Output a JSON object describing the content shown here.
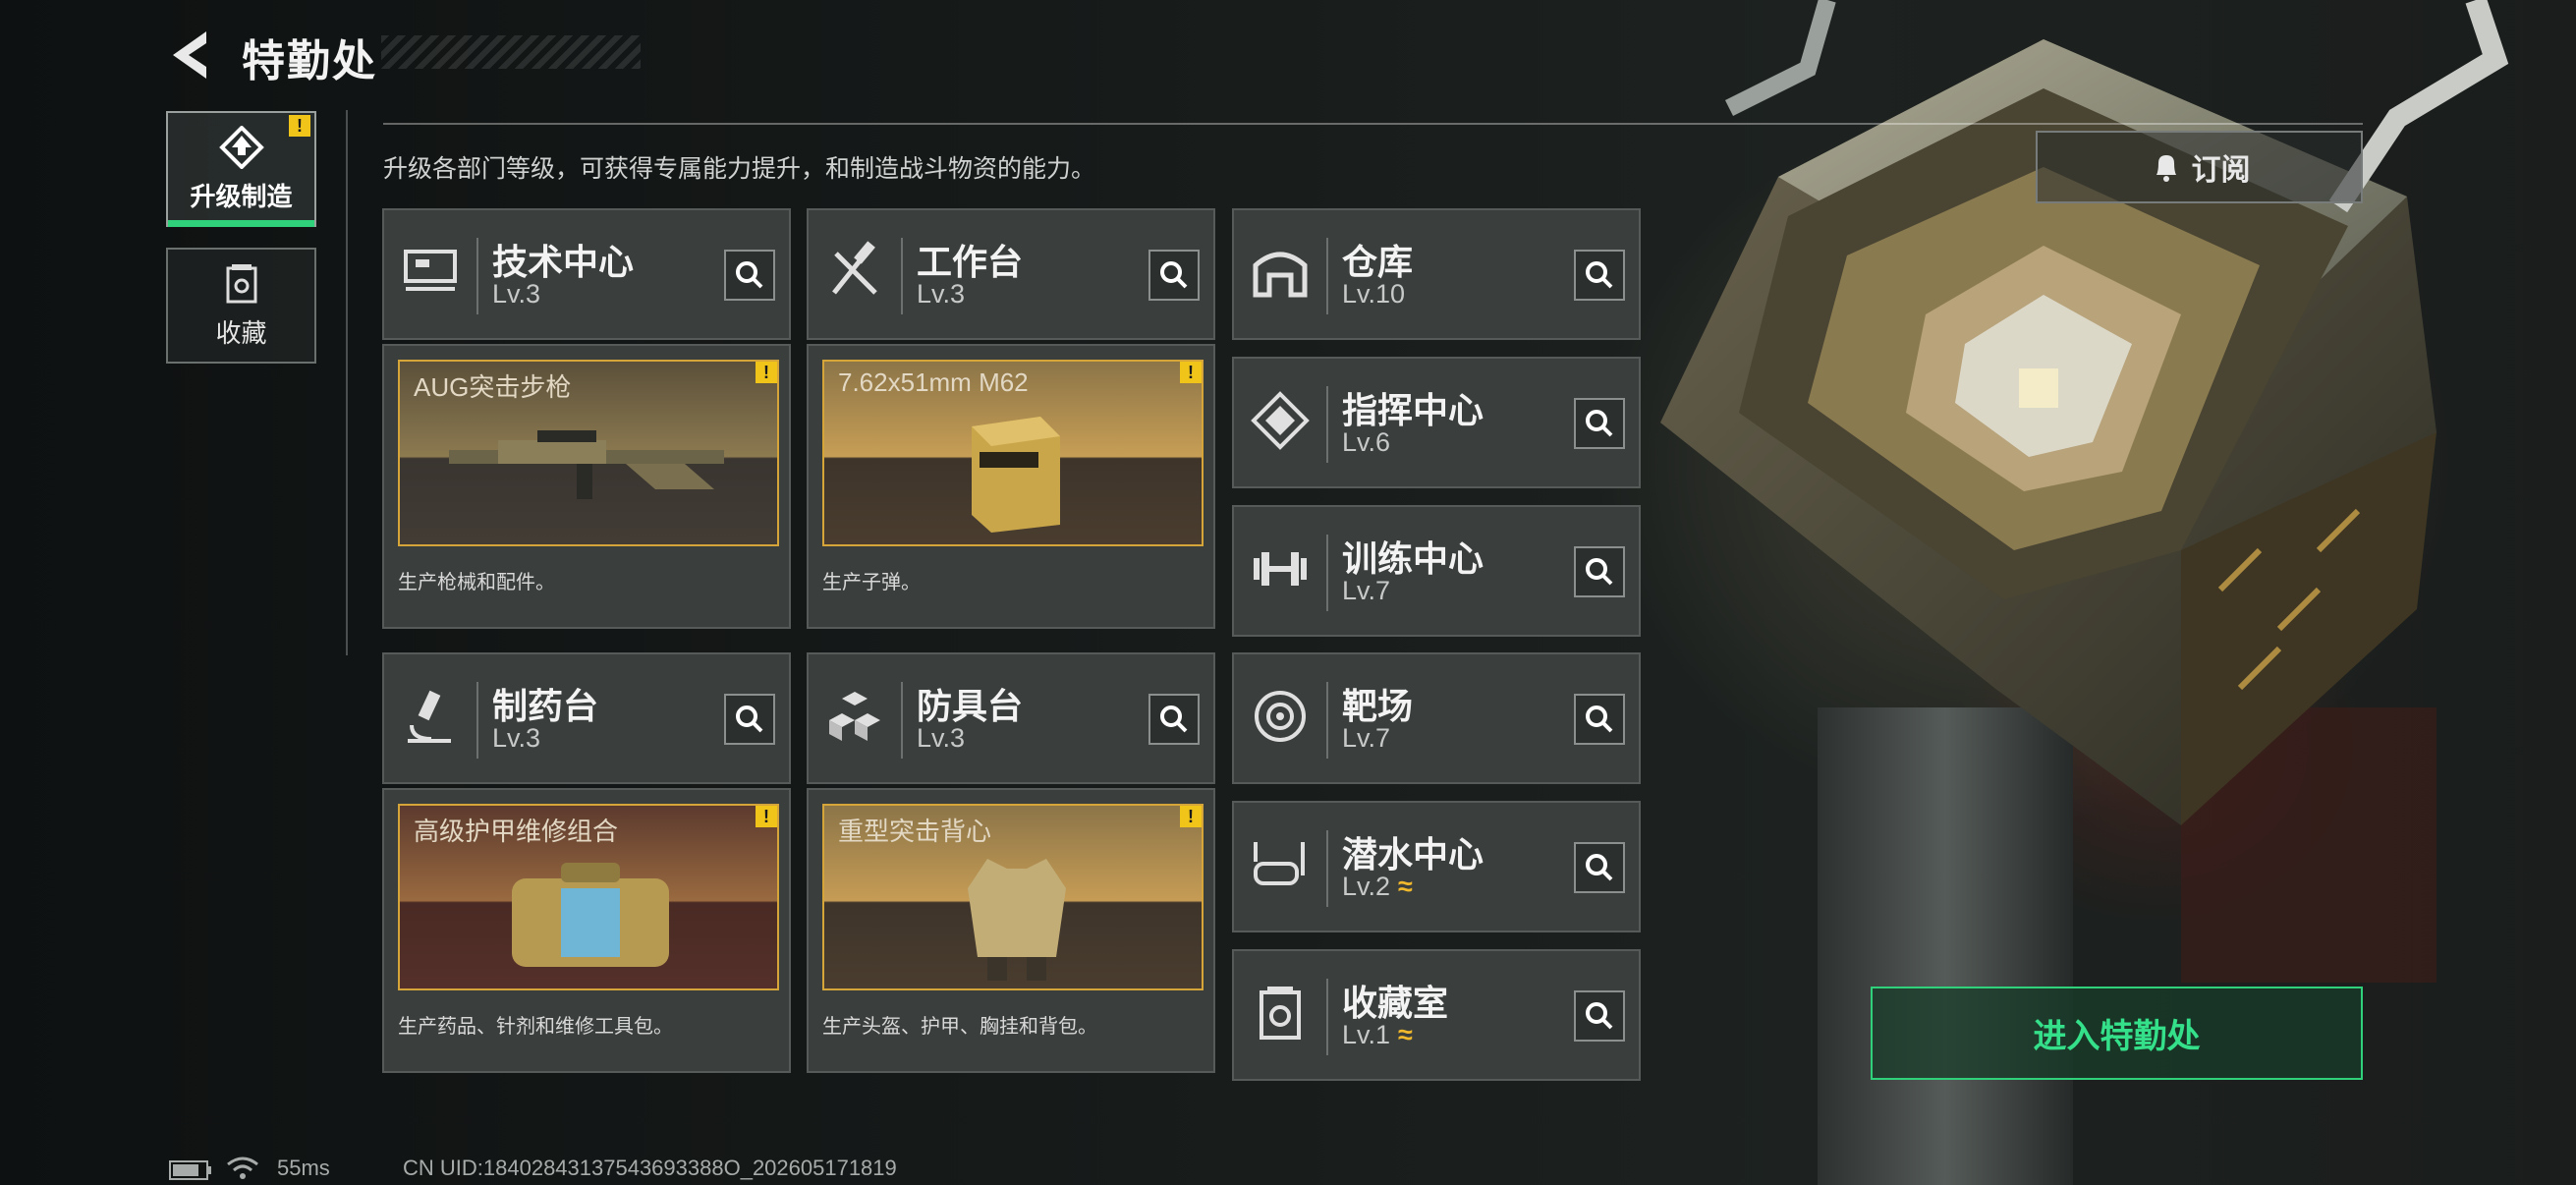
{
  "header": {
    "title": "特勤处"
  },
  "description": "升级各部门等级，可获得专属能力提升，和制造战斗物资的能力。",
  "nav": [
    {
      "label": "升级制造",
      "active": true,
      "warning": "!"
    },
    {
      "label": "收藏",
      "active": false
    }
  ],
  "production": [
    {
      "name": "技术中心",
      "level": "Lv.3",
      "icon": "computer-icon",
      "product": "AUG突击步枪",
      "desc": "生产枪械和配件。",
      "warning": "!"
    },
    {
      "name": "工作台",
      "level": "Lv.3",
      "icon": "tools-icon",
      "product": "7.62x51mm M62",
      "desc": "生产子弹。",
      "warning": "!"
    },
    {
      "name": "制药台",
      "level": "Lv.3",
      "icon": "microscope-icon",
      "product": "高级护甲维修组合",
      "desc": "生产药品、针剂和维修工具包。",
      "warning": "!"
    },
    {
      "name": "防具台",
      "level": "Lv.3",
      "icon": "cubes-icon",
      "product": "重型突击背心",
      "desc": "生产头盔、护甲、胸挂和背包。",
      "warning": "!"
    }
  ],
  "departments": [
    {
      "name": "仓库",
      "level": "Lv.10",
      "icon": "warehouse-icon"
    },
    {
      "name": "指挥中心",
      "level": "Lv.6",
      "icon": "command-icon"
    },
    {
      "name": "训练中心",
      "level": "Lv.7",
      "icon": "dumbbell-icon"
    },
    {
      "name": "靶场",
      "level": "Lv.7",
      "icon": "target-icon"
    },
    {
      "name": "潜水中心",
      "level": "Lv.2",
      "icon": "diving-mask-icon",
      "upgrade": "≈"
    },
    {
      "name": "收藏室",
      "level": "Lv.1",
      "icon": "collection-icon",
      "upgrade": "≈"
    }
  ],
  "subscribe_label": "订阅",
  "enter_label": "进入特勤处",
  "status": {
    "ping": "55ms",
    "uid": "CN UID:18402843137543693388O_202605171819"
  },
  "colors": {
    "accent": "#2fd27a",
    "warning": "#f0c419",
    "highlight": "#d6a53a"
  }
}
